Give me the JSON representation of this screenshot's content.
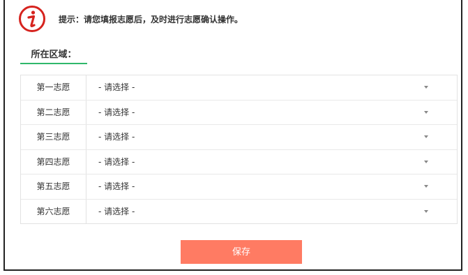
{
  "notice": {
    "icon": "info-icon",
    "icon_color": "#d6231e",
    "text": "提示：请您填报志愿后，及时进行志愿确认操作。"
  },
  "region": {
    "label": "所在区域："
  },
  "choices": [
    {
      "label": "第一志愿",
      "value": "- 请选择 -"
    },
    {
      "label": "第二志愿",
      "value": "- 请选择 -"
    },
    {
      "label": "第三志愿",
      "value": "- 请选择 -"
    },
    {
      "label": "第四志愿",
      "value": "- 请选择 -"
    },
    {
      "label": "第五志愿",
      "value": "- 请选择 -"
    },
    {
      "label": "第六志愿",
      "value": "- 请选择 -"
    }
  ],
  "actions": {
    "save_label": "保存",
    "save_color": "#ff7b63"
  },
  "colors": {
    "accent_underline": "#2fb86a"
  }
}
